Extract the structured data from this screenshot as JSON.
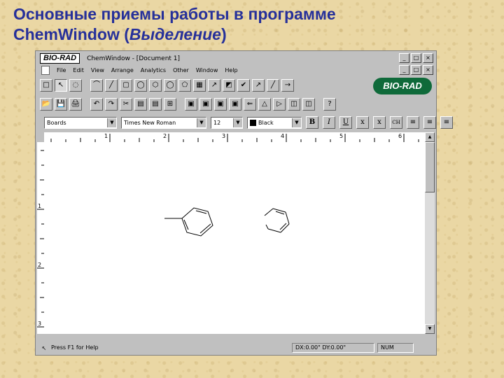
{
  "slide": {
    "title_line1": "Основные приемы работы в программе",
    "title_line2_prefix": "ChemWindow (",
    "title_line2_italic": "Выделение",
    "title_line2_suffix": ")"
  },
  "window": {
    "logo_text": "BIO-RAD",
    "title": "ChemWindow - [Document 1]",
    "title_buttons": [
      "_",
      "□",
      "×"
    ],
    "mdi_buttons": [
      "_",
      "□",
      "×"
    ]
  },
  "menu": {
    "items": [
      "File",
      "Edit",
      "View",
      "Arrange",
      "Analytics",
      "Other",
      "Window",
      "Help"
    ]
  },
  "toolbar1": {
    "tools": [
      "□",
      "↖",
      "◌",
      "⌒",
      "╱",
      "▢",
      "◯",
      "⬡",
      "◯",
      "⬠",
      "▦",
      "↗",
      "◩",
      "✔",
      "↗",
      "╱",
      "→"
    ]
  },
  "toolbar2": {
    "tools": [
      "📂",
      "💾",
      "🖨",
      "↶",
      "↷",
      "✂",
      "▤",
      "▤",
      "⊞",
      "▣",
      "▣",
      "▣",
      "▣",
      "⇐",
      "△",
      "▷",
      "◫",
      "◫",
      "?"
    ]
  },
  "brand_badge": "BIO-RAD",
  "format_bar": {
    "style_value": "Boards",
    "font_value": "Times New Roman",
    "size_value": "12",
    "color_value": "Black",
    "color_hex": "#000000",
    "buttons": [
      "B",
      "I",
      "U",
      "x",
      "x",
      "CH",
      "≡",
      "≡",
      "≡"
    ]
  },
  "rulers": {
    "h_labels": [
      "1",
      "2",
      "3",
      "4",
      "5",
      "6"
    ],
    "v_labels": [
      "1",
      "2",
      "3"
    ]
  },
  "status": {
    "help_text": "Press F1 for Help",
    "coords": "DX:0.00\" DY:0.00\"",
    "num": "NUM"
  }
}
